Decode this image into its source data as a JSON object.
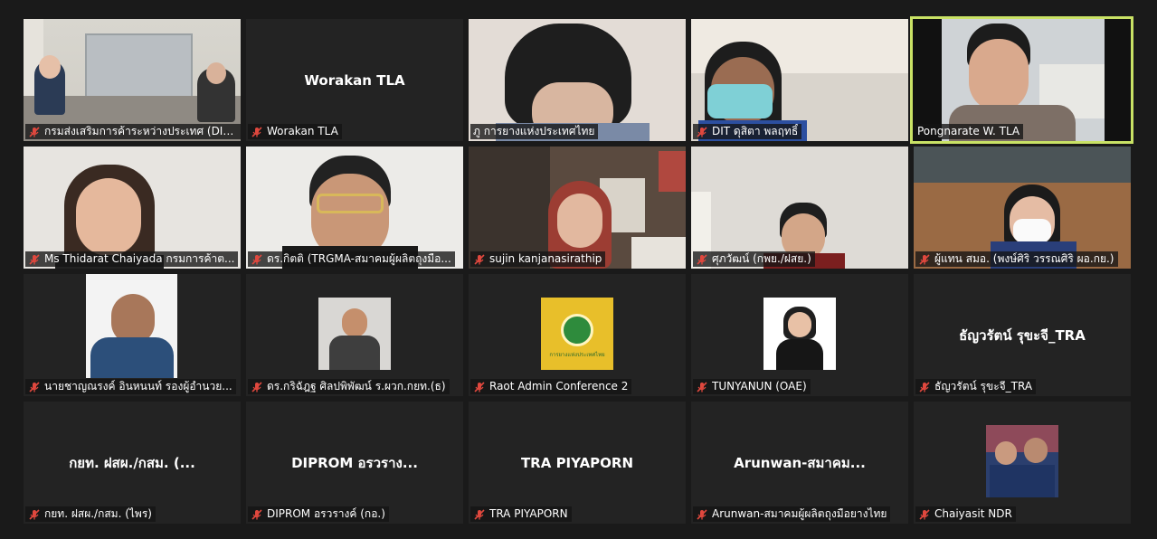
{
  "tiles": [
    {
      "label": "กรมส่งเสริมการค้าระหว่างประเทศ (DIT...",
      "muted": true
    },
    {
      "label": "Worakan TLA",
      "center_name": "Worakan TLA",
      "muted": true
    },
    {
      "label": "ภู การยางแห่งประเทศไทย",
      "muted": false
    },
    {
      "label": "DIT ดุสิตา พลฤทธิ์",
      "muted": true
    },
    {
      "label": "Pongnarate W. TLA",
      "muted": false,
      "active": true
    },
    {
      "label": "Ms Thidarat Chaiyada กรมการค้าต...",
      "muted": true
    },
    {
      "label": "ดร.กิตติ  (TRGMA-สมาคมผู้ผลิตถุงมือ...",
      "muted": true
    },
    {
      "label": "sujin kanjanasirathip",
      "muted": true
    },
    {
      "label": "ศุภวัฒน์ (กพย./ฝสย.)",
      "muted": true
    },
    {
      "label": "ผู้แทน สมอ. (พงษ์ศิริ วรรณศิริ ผอ.กย.)",
      "muted": true
    },
    {
      "label": "นายชาญณรงค์ อินหนนท์ รองผู้อำนวย...",
      "muted": true
    },
    {
      "label": "ดร.กริฉัฎฐ ศิลปพิพัฒน์ ร.ผวก.กยท.(ธ)",
      "muted": true
    },
    {
      "label": "Raot Admin Conference 2",
      "muted": true,
      "logo_text": "การยางแห่งประเทศไทย"
    },
    {
      "label": "TUNYANUN (OAE)",
      "muted": true
    },
    {
      "label": "ธัญวรัตน์ รุขะจี_TRA",
      "center_name": "ธัญวรัตน์ รุขะจี_TRA",
      "muted": true
    },
    {
      "label": "กยท. ฝสผ./กสม. (ไพร)",
      "center_name": "กยท. ฝสผ./กสม. (...",
      "muted": true
    },
    {
      "label": "DIPROM อรวรางค์ (กอ.)",
      "center_name": "DIPROM อรวราง...",
      "muted": true
    },
    {
      "label": "TRA PIYAPORN",
      "center_name": "TRA PIYAPORN",
      "muted": true
    },
    {
      "label": "Arunwan-สมาคมผู้ผลิตถุงมือยางไทย",
      "center_name": "Arunwan-สมาคม...",
      "muted": true
    },
    {
      "label": "Chaiyasit NDR",
      "muted": true
    }
  ],
  "colors": {
    "active_border": "#c9e265",
    "muted_icon": "#e0483e",
    "tile_bg": "#232323"
  }
}
